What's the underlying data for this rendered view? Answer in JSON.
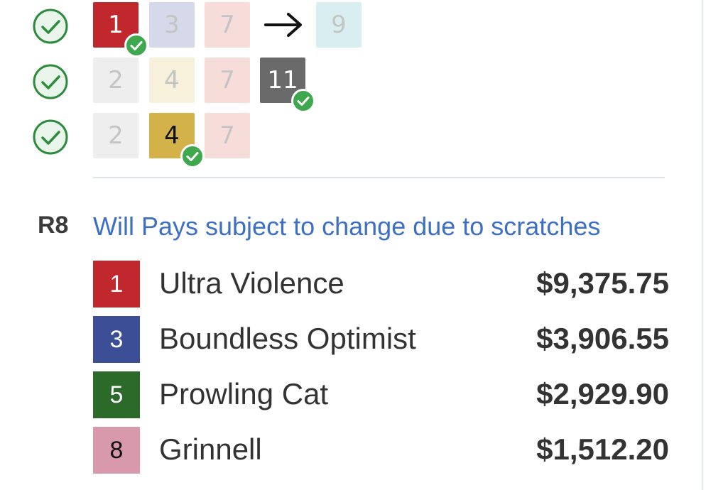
{
  "legs": [
    {
      "status_icon": "check-circle-icon",
      "tiles": [
        {
          "label": "1",
          "bg": "#c0282d",
          "state": "selected",
          "text": "light",
          "badge": "check-badge-icon"
        },
        {
          "label": "3",
          "bg": "#d5d9e9",
          "state": "faded"
        },
        {
          "label": "7",
          "bg": "#f6ddd9",
          "state": "faded"
        }
      ],
      "arrow_icon": "arrow-right-icon",
      "next": {
        "label": "9",
        "bg": "#d9eef0",
        "state": "faded"
      }
    },
    {
      "status_icon": "check-circle-icon",
      "tiles": [
        {
          "label": "2",
          "bg": "#eeeeee",
          "state": "faded"
        },
        {
          "label": "4",
          "bg": "#f7f0da",
          "state": "faded"
        },
        {
          "label": "7",
          "bg": "#f6ddd9",
          "state": "faded"
        },
        {
          "label": "11",
          "bg": "#6a6a6a",
          "state": "selected",
          "text": "light",
          "badge": "check-badge-icon"
        }
      ]
    },
    {
      "status_icon": "check-circle-icon",
      "tiles": [
        {
          "label": "2",
          "bg": "#eeeeee",
          "state": "faded"
        },
        {
          "label": "4",
          "bg": "#d4b24a",
          "state": "selected",
          "text": "dark",
          "badge": "check-badge-icon"
        },
        {
          "label": "7",
          "bg": "#f6ddd9",
          "state": "faded"
        }
      ]
    }
  ],
  "race": {
    "label": "R8",
    "note": "Will Pays subject to change due to scratches"
  },
  "payouts": [
    {
      "number": "1",
      "bg": "#c0282d",
      "fg": "#ffffff",
      "name": "Ultra Violence",
      "amount": "$9,375.75"
    },
    {
      "number": "3",
      "bg": "#3c4f96",
      "fg": "#ffffff",
      "name": "Boundless Optimist",
      "amount": "$3,906.55"
    },
    {
      "number": "5",
      "bg": "#2c6a2a",
      "fg": "#ffffff",
      "name": "Prowling Cat",
      "amount": "$2,929.90"
    },
    {
      "number": "8",
      "bg": "#d999ac",
      "fg": "#111111",
      "name": "Grinnell",
      "amount": "$1,512.20"
    }
  ],
  "colors": {
    "accent_link": "#3d6fc2",
    "success_green": "#2e8b3e",
    "badge_green": "#3fa84f"
  }
}
